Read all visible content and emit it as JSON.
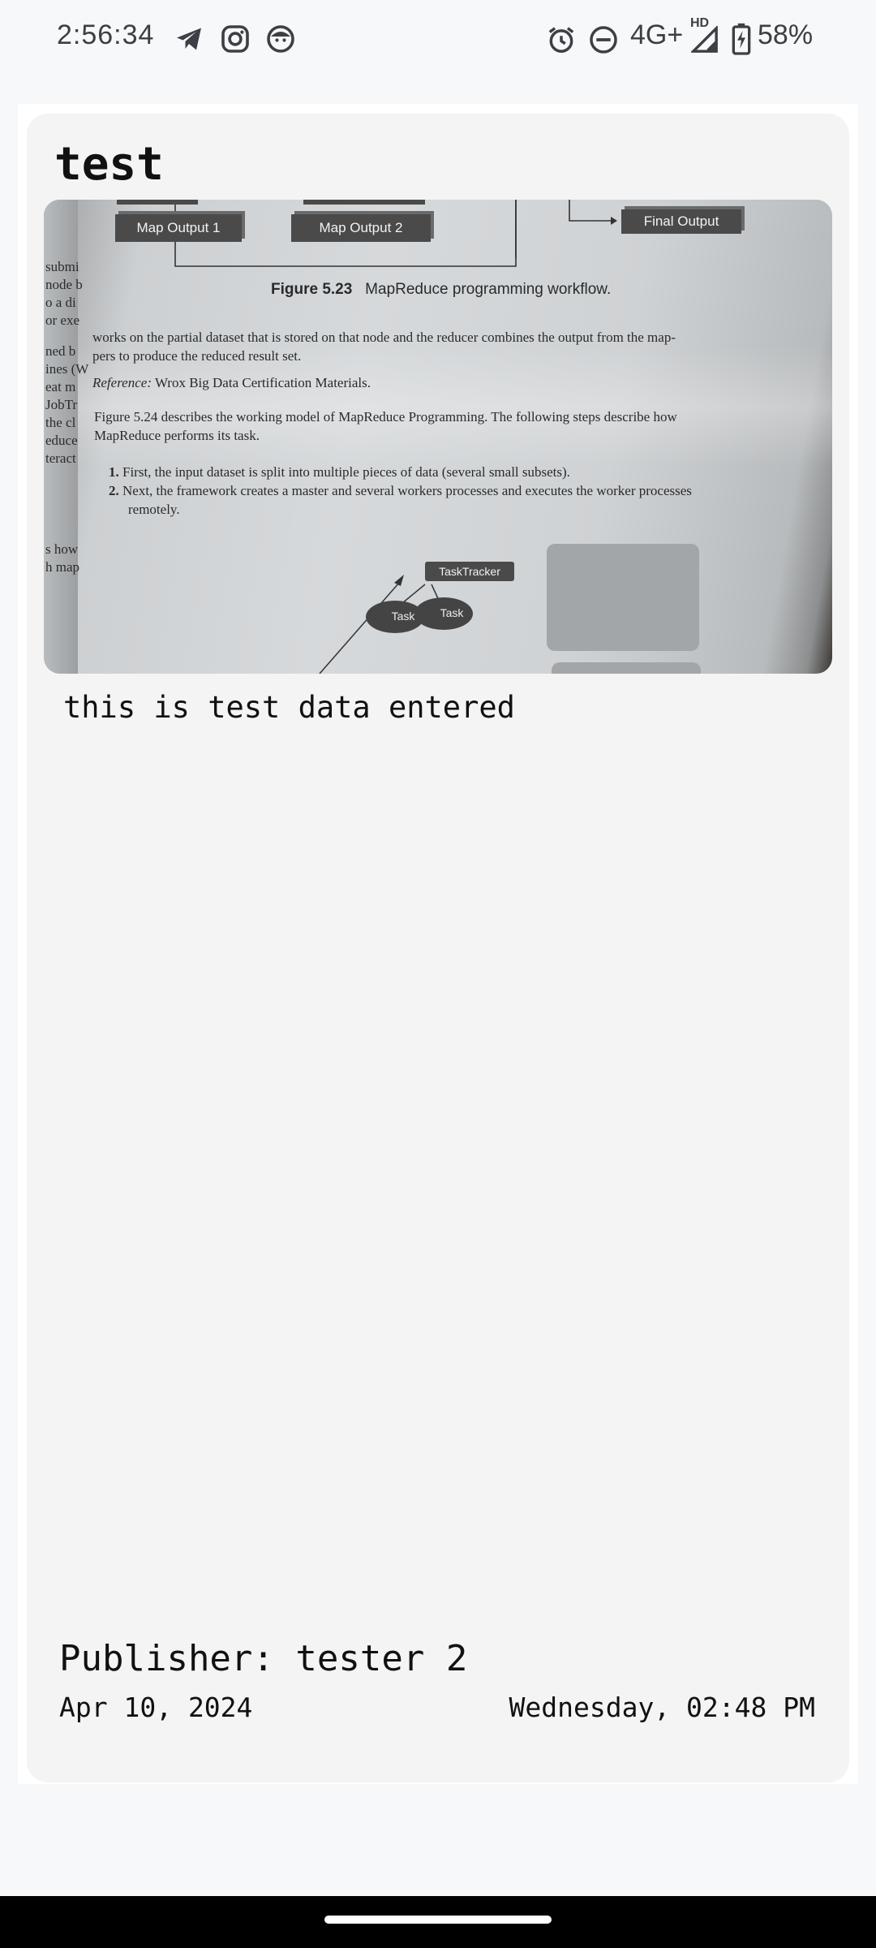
{
  "status_bar": {
    "time": "2:56:34",
    "network": "4G+",
    "network_badge": "HD",
    "battery": "58%",
    "left_icons": [
      "telegram-icon",
      "instagram-icon",
      "face-icon"
    ],
    "right_icons": [
      "alarm-icon",
      "do-not-disturb-icon",
      "signal-icon",
      "battery-charging-icon"
    ]
  },
  "note": {
    "title": "test",
    "body": "this is test data entered",
    "publisher": "Publisher: tester 2",
    "date": "Apr 10, 2024",
    "day_time": "Wednesday, 02:48 PM",
    "image": {
      "box_map1": "Map Output 1",
      "box_map2": "Map Output 2",
      "box_final": "Final Output",
      "fig_label": "Figure 5.23",
      "fig_caption": "MapReduce programming workflow.",
      "line1": "works on the partial dataset that is stored on that node and the reducer combines the output from the map-",
      "line2": "pers to produce the reduced result set.",
      "ref_label": "Reference:",
      "ref_text": "Wrox Big Data Certification Materials.",
      "line3": "Figure 5.24 describes the working model of MapReduce Programming. The following steps describe how",
      "line4": "MapReduce performs its task.",
      "step1_num": "1.",
      "step1": "First, the input dataset is split into multiple pieces of data (several small subsets).",
      "step2_num": "2.",
      "step2": "Next, the framework creates a master and several workers processes and executes the worker processes",
      "step2b": "remotely.",
      "tasktracker": "TaskTracker",
      "task1": "Task",
      "task2": "Task",
      "margin_left": [
        "submi",
        "node b",
        "o a di",
        "or exe",
        "ned b",
        "ines (W",
        "eat m",
        "JobTr",
        "the cl",
        "educe",
        "teract",
        "s how",
        "h map"
      ]
    }
  }
}
